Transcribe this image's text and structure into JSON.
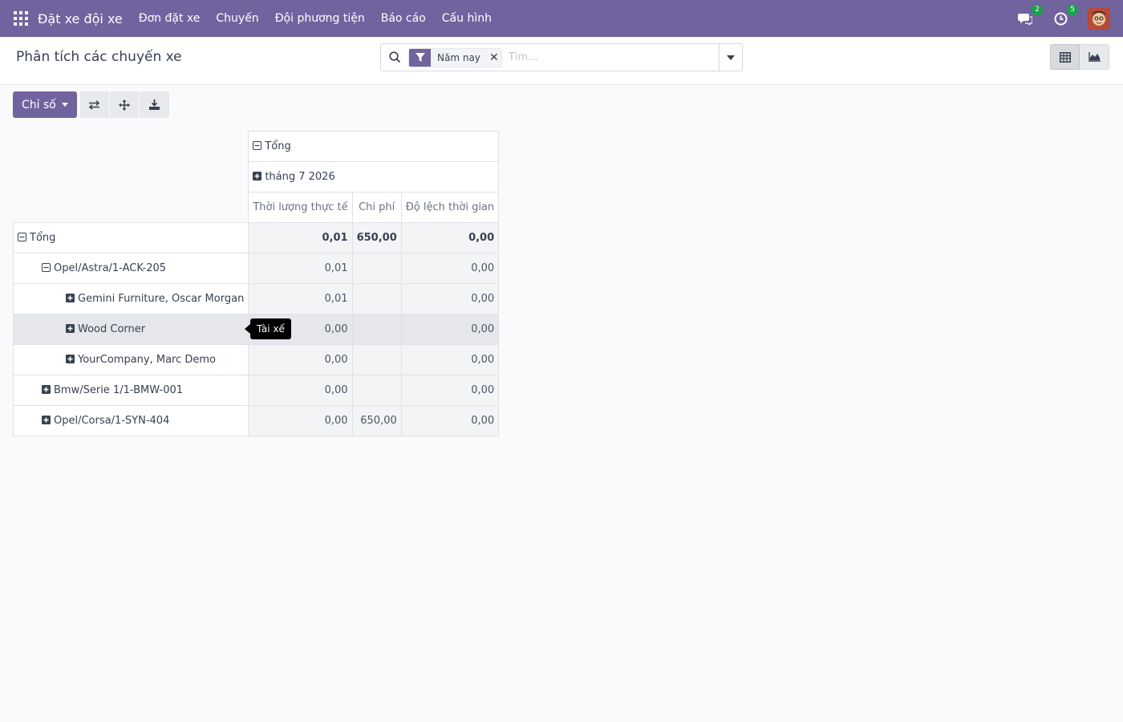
{
  "navbar": {
    "brand": "Đặt xe đội xe",
    "menu": [
      "Đơn đặt xe",
      "Chuyến",
      "Đội phương tiện",
      "Báo cáo",
      "Cấu hình"
    ],
    "messages_count": "2",
    "activities_count": "5"
  },
  "control_panel": {
    "title": "Phân tích các chuyến xe",
    "facet_value": "Năm nay",
    "search_placeholder": "Tìm..."
  },
  "pivot_toolbar": {
    "measures_label": "Chỉ số"
  },
  "pivot": {
    "col_total_label": "Tổng",
    "col_group_label": "tháng 7 2026",
    "measures": [
      "Thời lượng thực tế",
      "Chi phí",
      "Độ lệch thời gian"
    ],
    "rows": [
      {
        "label": "Tổng",
        "level": 0,
        "expanded": true,
        "values": [
          "0,01",
          "650,00",
          "0,00"
        ]
      },
      {
        "label": "Opel/Astra/1-ACK-205",
        "level": 1,
        "expanded": true,
        "values": [
          "0,01",
          "",
          "0,00"
        ]
      },
      {
        "label": "Gemini Furniture, Oscar Morgan",
        "level": 2,
        "expanded": false,
        "values": [
          "0,01",
          "",
          "0,00"
        ]
      },
      {
        "label": "Wood Corner",
        "level": 2,
        "expanded": false,
        "values": [
          "0,00",
          "",
          "0,00"
        ]
      },
      {
        "label": "YourCompany, Marc Demo",
        "level": 2,
        "expanded": false,
        "values": [
          "0,00",
          "",
          "0,00"
        ]
      },
      {
        "label": "Bmw/Serie 1/1-BMW-001",
        "level": 1,
        "expanded": false,
        "values": [
          "0,00",
          "",
          "0,00"
        ]
      },
      {
        "label": "Opel/Corsa/1-SYN-404",
        "level": 1,
        "expanded": false,
        "values": [
          "0,00",
          "650,00",
          "0,00"
        ]
      }
    ]
  },
  "tooltip": "Tài xế"
}
